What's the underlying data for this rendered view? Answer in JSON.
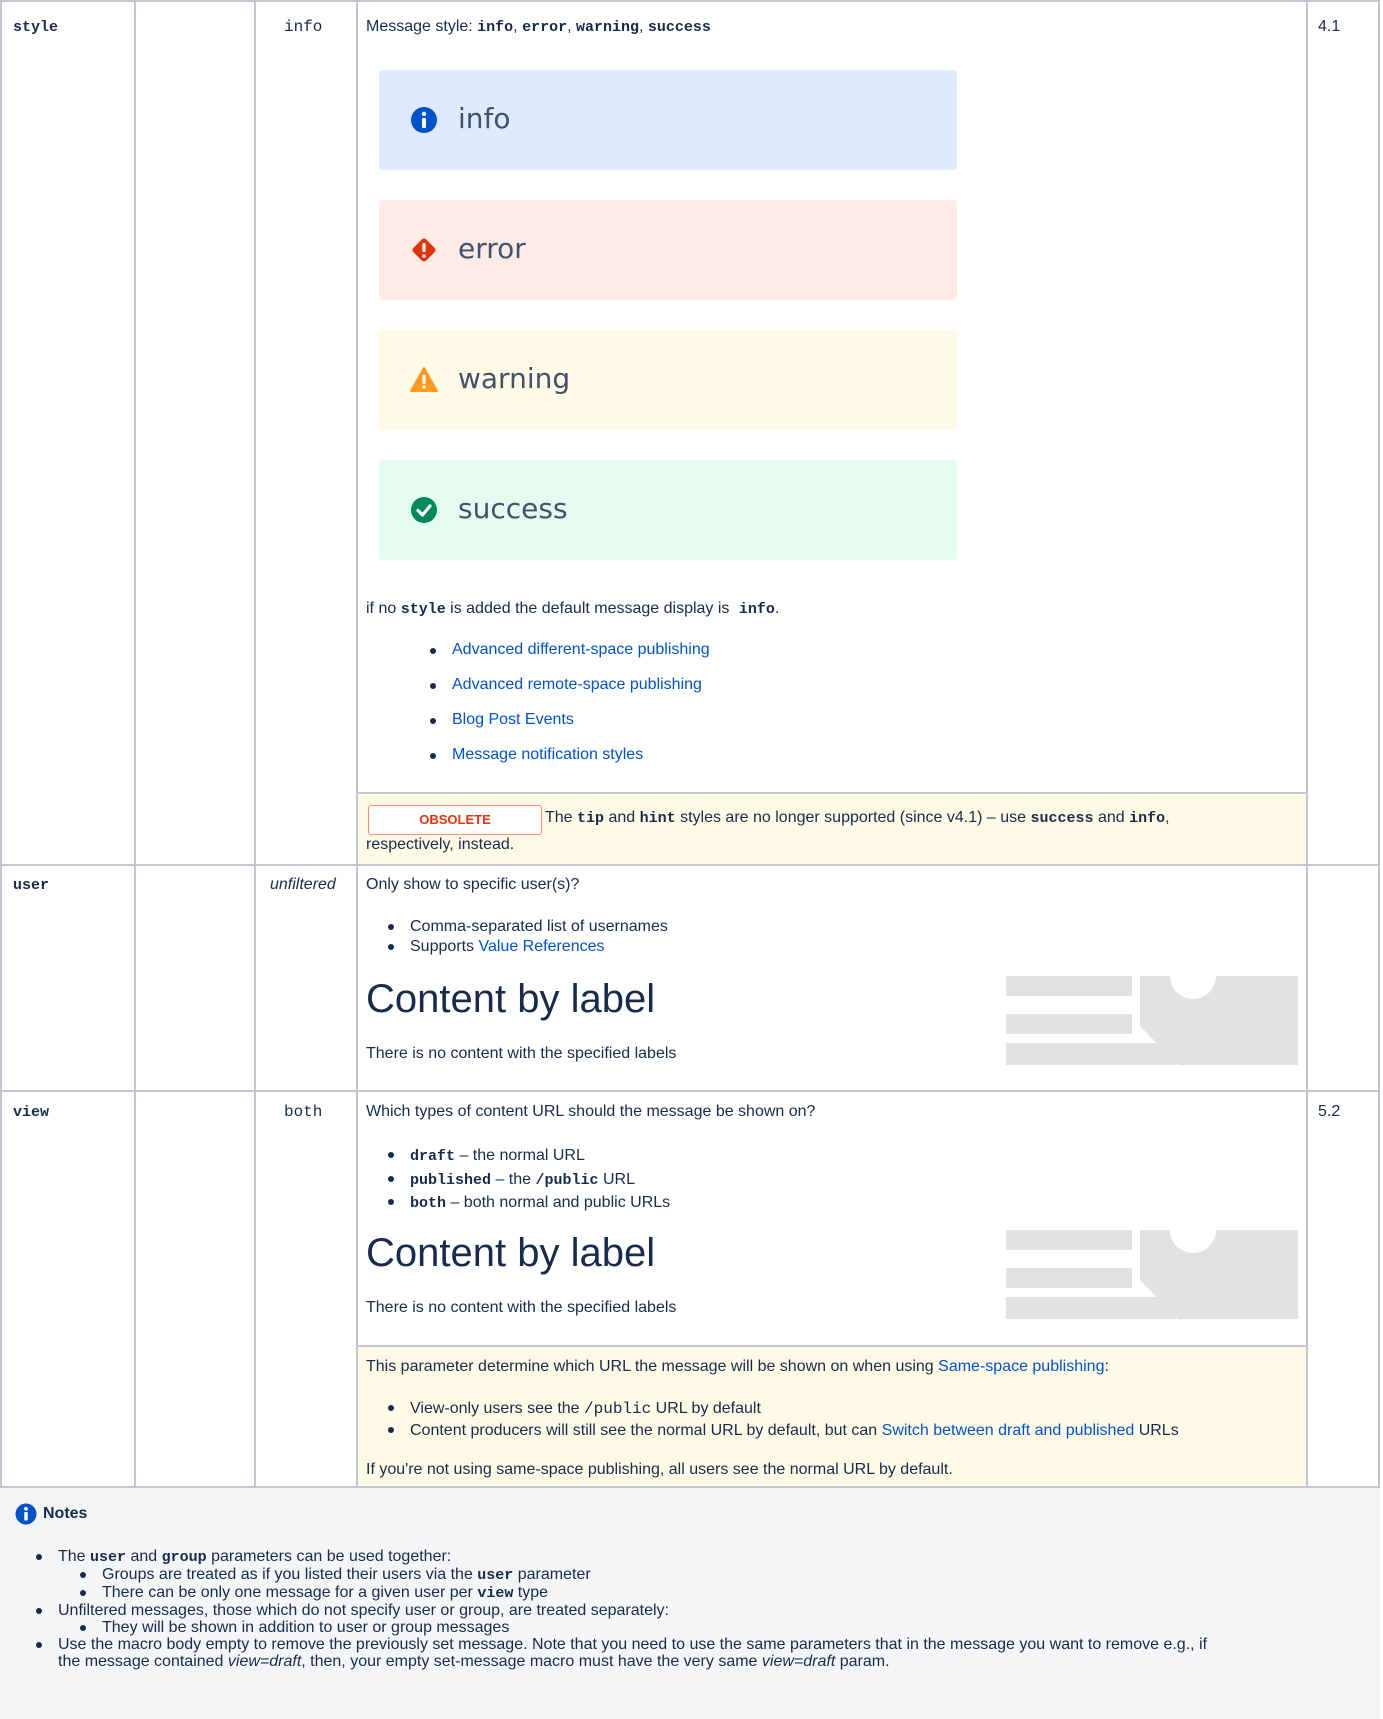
{
  "rows": [
    {
      "name": "style",
      "default": "info",
      "description_prefix": "Message style: ",
      "styles": [
        "info",
        "error",
        "warning",
        "success"
      ],
      "previews": [
        {
          "label": "info",
          "bg": "#deebff",
          "icon": "info-circle-icon",
          "color": "#0052cc"
        },
        {
          "label": "error",
          "bg": "#ffebe6",
          "icon": "error-diamond-icon",
          "color": "#de350b"
        },
        {
          "label": "warning",
          "bg": "#fffae6",
          "icon": "warning-triangle-icon",
          "color": "#ff991f"
        },
        {
          "label": "success",
          "bg": "#e3fcef",
          "icon": "check-circle-icon",
          "color": "#00875a"
        }
      ],
      "default_note": {
        "pre": "if no ",
        "code": "style",
        "mid": " is added the default message display is ",
        "code2": "info",
        "post": "."
      },
      "related_links": [
        "Advanced different-space publishing",
        "Advanced remote-space publishing",
        "Blog Post Events",
        "Message notification styles"
      ],
      "obsolete": {
        "badge": "OBSOLETE",
        "t1": " The ",
        "c1": "tip",
        "t2": " and ",
        "c2": "hint",
        "t3": " styles are no longer supported (since v4.1) – use ",
        "c3": "success",
        "t4": " and ",
        "c4": "info",
        "t5": ",",
        "line2": "respectively, instead."
      },
      "version": "4.1"
    },
    {
      "name": "user",
      "default": "unfiltered",
      "description": "Only show to specific user(s)?",
      "bullets": [
        "Comma-separated list of usernames",
        "Supports "
      ],
      "bullet_link": "Value References",
      "cbl_title": "Content by label",
      "cbl_empty": "There is no content with the specified labels",
      "version": ""
    },
    {
      "name": "view",
      "default": "both",
      "description": "Which types of content URL should the message be shown on?",
      "bullets": [
        {
          "code": "draft",
          "text": " – the normal URL"
        },
        {
          "code": "published",
          "text": " – the ",
          "code2": "/public",
          "text2": " URL"
        },
        {
          "code": "both",
          "text": " – both normal and public URLs"
        }
      ],
      "cbl_title": "Content by label",
      "cbl_empty": "There is no content with the specified labels",
      "note": {
        "intro": "This parameter determine which URL the message will be shown on when using ",
        "intro_link": "Same-space publishing",
        "intro_end": ":",
        "b1_pre": "View-only users see the ",
        "b1_code": "/public",
        "b1_post": " URL by default",
        "b2_pre": "Content producers will still see the normal URL by default, but can ",
        "b2_link": "Switch between draft and published",
        "b2_post": " URLs",
        "footer": "If you're not using same-space publishing, all users see the normal URL by default."
      },
      "version": "5.2"
    }
  ],
  "notes": {
    "title": "Notes",
    "l1_pre": "The ",
    "l1_c1": "user",
    "l1_mid": " and ",
    "l1_c2": "group",
    "l1_post": " parameters can be used together:",
    "l1a_pre": "Groups are treated as if you listed their users via the ",
    "l1a_code": "user",
    "l1a_post": " parameter",
    "l1b_pre": "There can be only one message for a given user per ",
    "l1b_code": "view",
    "l1b_post": " type",
    "l2": "Unfiltered messages, those which do not specify user or group, are treated separately:",
    "l2a": "They will be shown in addition to user or group messages",
    "l3_line1": "Use the macro body empty to remove the previously set message. Note that you need to use the same parameters that in the message you want to remove e.g., if",
    "l3_pre": "the message contained ",
    "l3_em1": "view=draft",
    "l3_mid": ", then, your empty set-message macro must have the very same ",
    "l3_em2": "view=draft",
    "l3_post": " param."
  }
}
